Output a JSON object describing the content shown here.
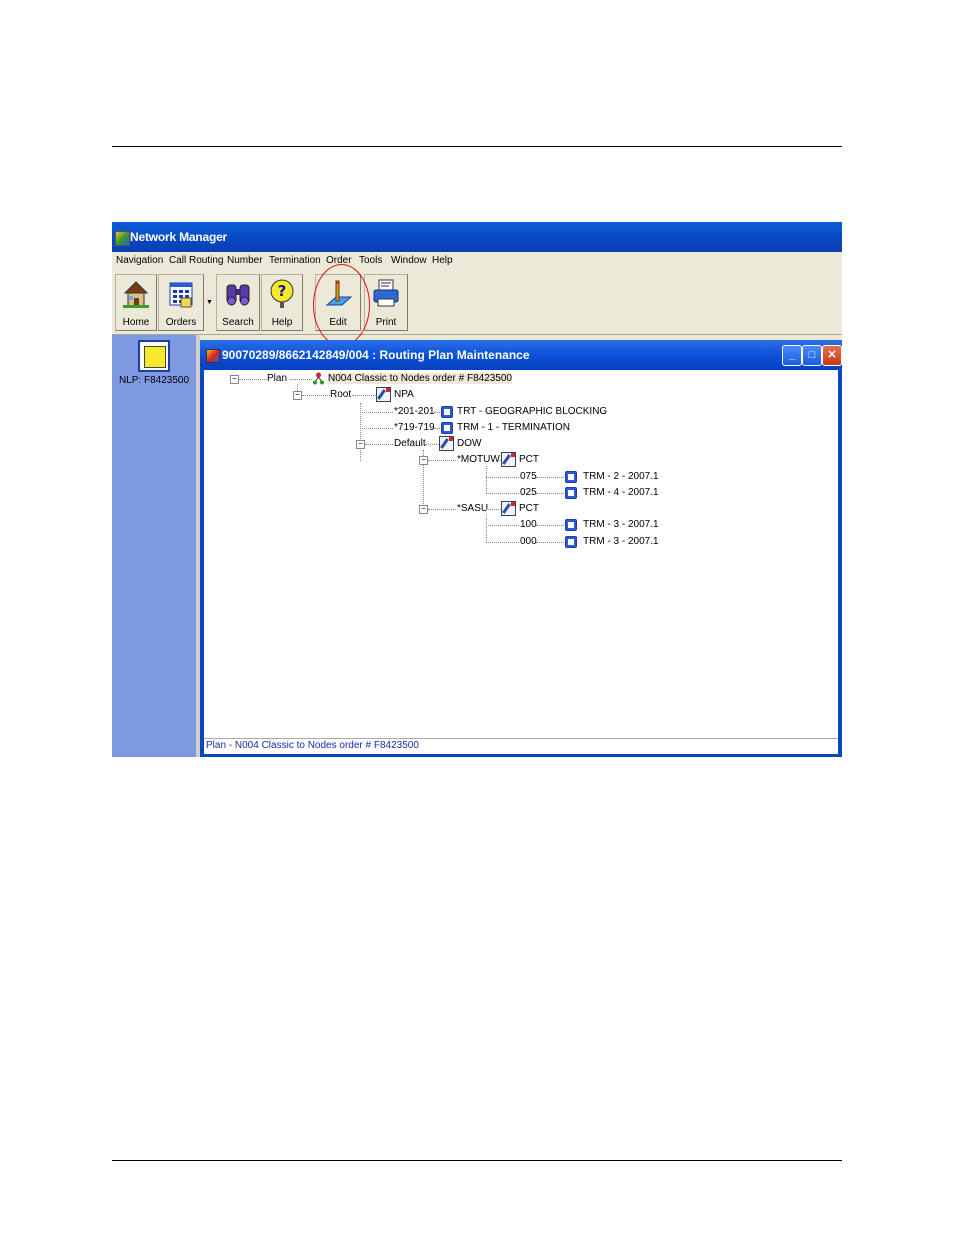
{
  "app": {
    "title": "Network Manager",
    "menu": [
      "Navigation",
      "Call Routing",
      "Number",
      "Termination",
      "Order",
      "Tools",
      "Window",
      "Help"
    ]
  },
  "toolbar": {
    "home": "Home",
    "orders": "Orders",
    "search": "Search",
    "help": "Help",
    "edit": "Edit",
    "print": "Print"
  },
  "left_panel": {
    "nlp_label": "NLP: F8423500"
  },
  "child_window": {
    "title": "90070289/8662142849/004 : Routing Plan Maintenance",
    "status": "Plan - N004  Classic to Nodes  order #  F8423500"
  },
  "tree": {
    "plan": "Plan",
    "plan_node": "N004  Classic to Nodes  order #  F8423500",
    "root": "Root",
    "npa": "NPA",
    "r201": "*201-201",
    "trt": "TRT - GEOGRAPHIC BLOCKING",
    "r719": "*719-719",
    "trm1": "TRM - 1 - TERMINATION",
    "default": "Default",
    "dow": "DOW",
    "motuw": "*MOTUW",
    "pct1": "PCT",
    "p075": "075",
    "trm2": "TRM - 2 - 2007.1",
    "p025": "025",
    "trm4": "TRM - 4 - 2007.1",
    "sasu": "*SASU",
    "pct2": "PCT",
    "p100": "100",
    "trm3a": "TRM - 3 - 2007.1",
    "p000": "000",
    "trm3b": "TRM - 3 - 2007.1"
  }
}
